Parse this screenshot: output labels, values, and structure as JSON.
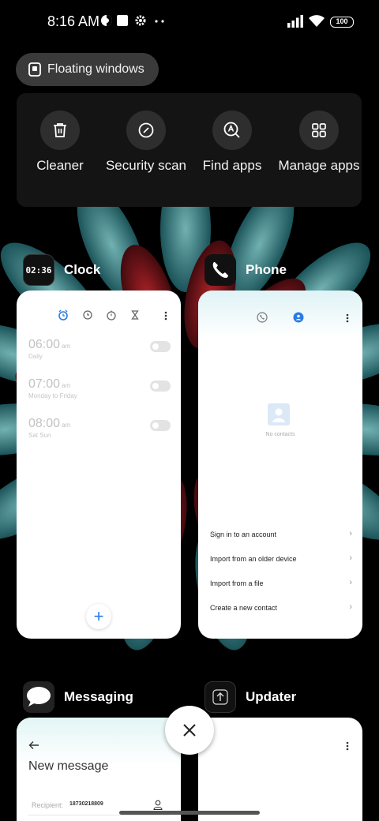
{
  "status_bar": {
    "time": "8:16 AM",
    "battery": "100",
    "icons": [
      "data-saver-icon",
      "square-notification-icon",
      "settings-gear-icon",
      "more-dots-icon",
      "signal-icon",
      "wifi-icon",
      "battery-icon"
    ]
  },
  "floating_windows": {
    "label": "Floating windows",
    "icon": "floating-window-icon"
  },
  "tools": [
    {
      "label": "Cleaner",
      "icon": "trash-icon"
    },
    {
      "label": "Security scan",
      "icon": "security-scan-icon"
    },
    {
      "label": "Find apps",
      "icon": "find-apps-icon"
    },
    {
      "label": "Manage apps",
      "icon": "grid-apps-icon"
    }
  ],
  "apps": {
    "clock": {
      "name": "Clock",
      "icon_text": "02:36",
      "alarms": [
        {
          "time": "06:00",
          "ampm": "am",
          "repeat": "Daily"
        },
        {
          "time": "07:00",
          "ampm": "am",
          "repeat": "Monday to Friday"
        },
        {
          "time": "08:00",
          "ampm": "am",
          "repeat": "Sat Sun"
        }
      ],
      "fab": "+"
    },
    "phone": {
      "name": "Phone",
      "empty_text": "No contacts",
      "menu": [
        "Sign in to an account",
        "Import from an older device",
        "Import from a file",
        "Create a new contact"
      ]
    },
    "messaging": {
      "name": "Messaging",
      "title": "New message",
      "recipient_label": "Recipient:",
      "recipient_value": "18730218809"
    },
    "updater": {
      "name": "Updater"
    }
  },
  "colors": {
    "accent": "#2a7be4",
    "panel": "#141414",
    "pill": "#3a3a3a"
  }
}
